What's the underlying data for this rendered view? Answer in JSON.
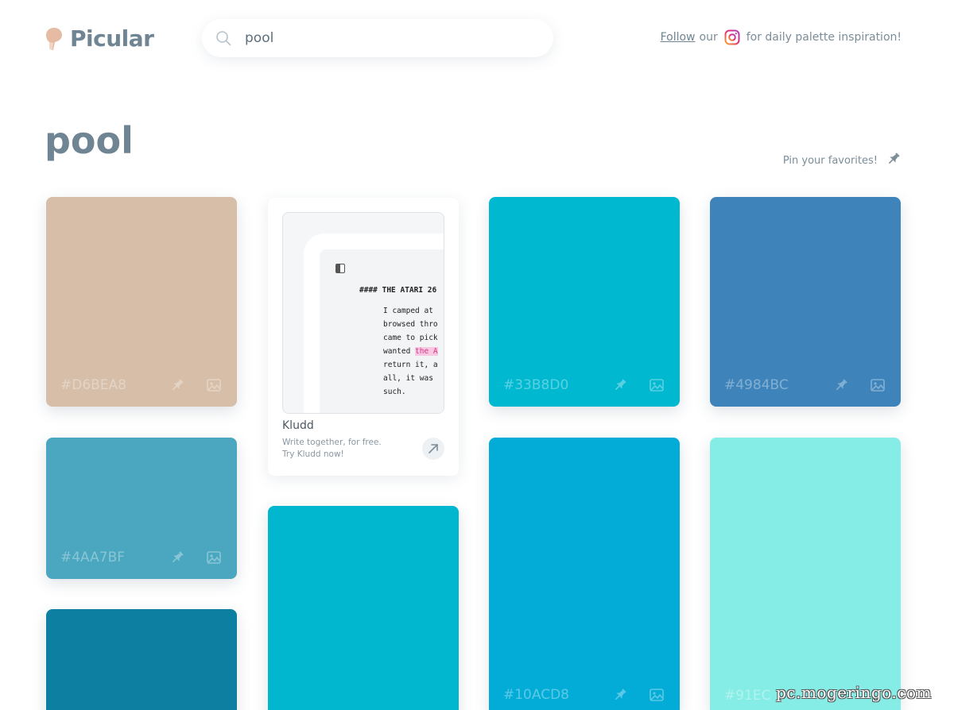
{
  "header": {
    "logo_text": "Picular",
    "search": {
      "value": "pool",
      "placeholder": ""
    },
    "follow": {
      "link_text": "Follow",
      "mid_text": "our",
      "tail_text": "for daily palette inspiration!"
    }
  },
  "page_title": "pool",
  "pin_hint": "Pin your favorites!",
  "colors": {
    "brand": "#6f8593",
    "logo_accent": "#e3b8a0",
    "instagram": "#d63c8a"
  },
  "cards": [
    {
      "hex": "#D6BEA8",
      "color": "#D6BEA8"
    },
    {
      "hex": "#4AA7BF",
      "color": "#4AA7BF"
    },
    {
      "hex": "",
      "color": "#0D7FA0"
    },
    {
      "hex": "",
      "color": "#00B7CF"
    },
    {
      "hex": "#33B8D0",
      "color": "#01B8D1"
    },
    {
      "hex": "#10ACD8",
      "color": "#03ACD7"
    },
    {
      "hex": "#4984BC",
      "color": "#3E84BB"
    },
    {
      "hex": "#91EC",
      "color": "#86EDE6"
    }
  ],
  "ad": {
    "title": "Kludd",
    "desc_line1": "Write together, for free.",
    "desc_line2": "Try Kludd now!",
    "doc_heading": "#### THE ATARI 26",
    "doc_lines": [
      "I camped at",
      "browsed thro",
      "came to pick",
      "wanted ",
      "return it, a",
      "all, it was",
      "such."
    ],
    "doc_highlight": "the A"
  },
  "watermark": "pc.mogeringo.com"
}
